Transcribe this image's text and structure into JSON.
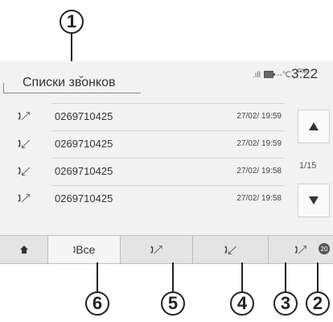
{
  "header": {
    "title": "Списки звонков",
    "status_indicators": "--℃",
    "am_pm": "PM",
    "time": "3:22"
  },
  "calls": [
    {
      "type": "outgoing-call-icon",
      "number": "0269710425",
      "datetime": "27/02/ 19:59"
    },
    {
      "type": "incoming-call-icon",
      "number": "0269710425",
      "datetime": "27/02/ 19:59"
    },
    {
      "type": "incoming-call-icon",
      "number": "0269710425",
      "datetime": "27/02/ 19:58"
    },
    {
      "type": "outgoing-call-icon",
      "number": "0269710425",
      "datetime": "27/02/ 19:58"
    }
  ],
  "pagination": {
    "indicator": "1/15"
  },
  "tabs": {
    "home_icon": "home-icon",
    "all_label": "Все",
    "outgoing_icon": "outgoing-call-icon",
    "incoming_icon": "incoming-call-icon",
    "missed_icon": "missed-call-icon"
  },
  "callouts": [
    "1",
    "2",
    "3",
    "4",
    "5",
    "6"
  ]
}
